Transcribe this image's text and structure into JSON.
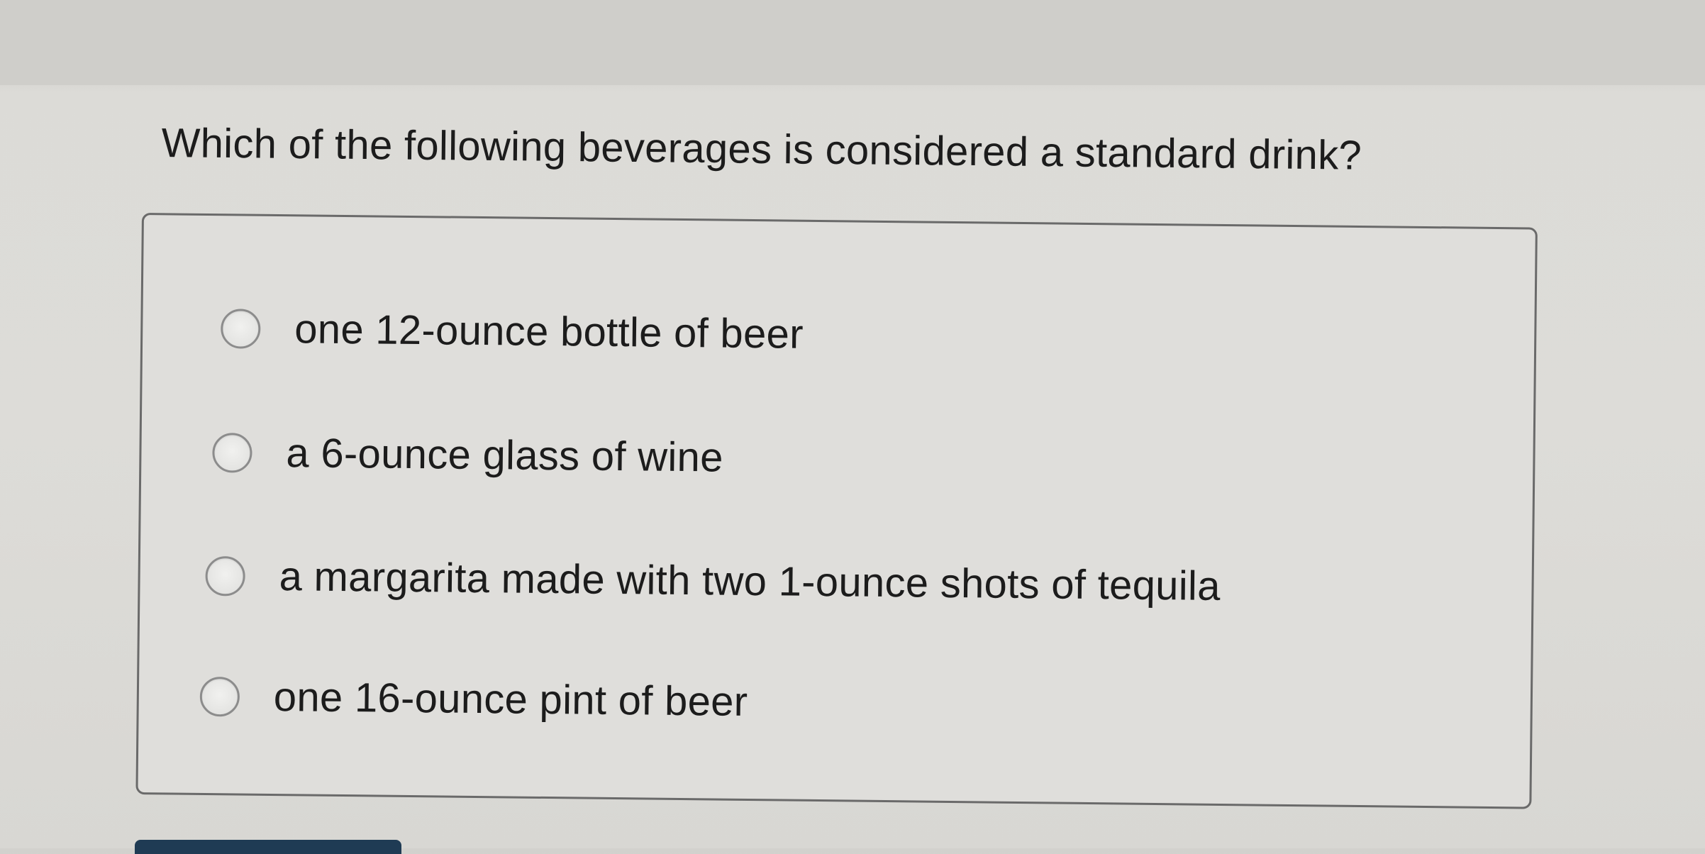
{
  "question": {
    "text": "Which of the following beverages is considered a standard drink?"
  },
  "options": [
    {
      "label": "one 12-ounce bottle of beer",
      "selected": false
    },
    {
      "label": "a 6-ounce glass of wine",
      "selected": false
    },
    {
      "label": "a margarita made with two 1-ounce shots of tequila",
      "selected": false
    },
    {
      "label": "one 16-ounce pint of beer",
      "selected": false
    }
  ],
  "colors": {
    "background": "#dddcd8",
    "box_border": "#6a6a6a",
    "text": "#1c1c1c",
    "button": "#1f3b54"
  }
}
